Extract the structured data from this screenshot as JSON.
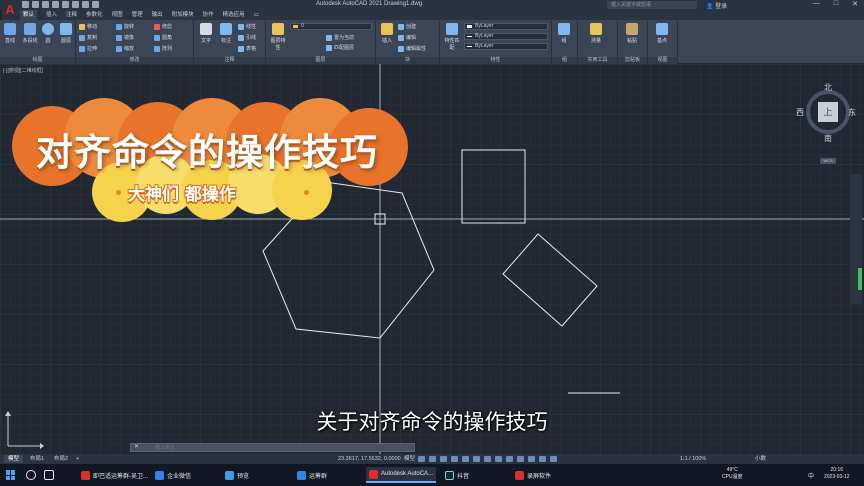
{
  "window": {
    "title": "Autodesk AutoCAD 2021    Drawing1.dwg",
    "search_placeholder": "键入关键字或短语",
    "login_label": "登录",
    "minimize": "—",
    "maximize": "□",
    "close": "✕"
  },
  "ribbon_tabs": [
    "默认",
    "插入",
    "注释",
    "参数化",
    "视图",
    "管理",
    "输出",
    "附加模块",
    "协作",
    "精选应用",
    "▭"
  ],
  "ribbon": {
    "groups": [
      {
        "label": "绘图",
        "buttons": [
          "直线",
          "多段线",
          "圆",
          "圆弧"
        ]
      },
      {
        "label": "修改",
        "buttons": [
          "移动",
          "旋转",
          "修剪",
          "复制",
          "镜像",
          "圆角",
          "拉伸",
          "缩放",
          "阵列"
        ]
      },
      {
        "label": "注释",
        "buttons": [
          "文字",
          "标注",
          "线性",
          "引线",
          "表格"
        ]
      },
      {
        "label": "图层",
        "buttons": [
          "图层特性",
          "置为当前",
          "匹配图层"
        ]
      },
      {
        "label": "块",
        "buttons": [
          "插入",
          "创建",
          "编辑",
          "编辑属性"
        ]
      },
      {
        "label": "特性",
        "buttons": [
          "特性匹配"
        ]
      },
      {
        "label": "组",
        "buttons": [
          "组"
        ]
      },
      {
        "label": "实用工具",
        "buttons": [
          "测量"
        ]
      },
      {
        "label": "剪贴板",
        "buttons": [
          "粘贴"
        ]
      },
      {
        "label": "视图",
        "buttons": [
          "基点"
        ]
      }
    ],
    "layer_combo": "0",
    "color_combo": "ByLayer",
    "linetype_combo": "ByLayer",
    "lineweight_combo": "ByLayer"
  },
  "viewport_label": "[-][俯视][二维线框]",
  "navcube": {
    "top": "上",
    "north": "北",
    "south": "南",
    "east": "东",
    "west": "西",
    "wcs": "WCS"
  },
  "overlay": {
    "title": "对齐命令的操作技巧",
    "subtitle": "大神们 都操作"
  },
  "caption": "关于对齐命令的操作技巧",
  "command_line": {
    "close": "✕",
    "placeholder": "键入命令"
  },
  "layout_tabs": [
    "模型",
    "布局1",
    "布局2",
    "+"
  ],
  "status": {
    "coordinates": "23.3617, 17.5632, 0.0000",
    "mode": "模型",
    "scale": "1:1 / 100%",
    "units": "小数"
  },
  "taskbar": {
    "apps": [
      {
        "label": "即巴适运筹群-吴卫...",
        "color": "#d8312c"
      },
      {
        "label": "企业微信",
        "color": "#2d86e3"
      },
      {
        "label": "预览",
        "color": "#3e9be8"
      },
      {
        "label": "运筹群",
        "color": "#2d86e3"
      },
      {
        "label": "Autodesk AutoCA...",
        "color": "#d8312c",
        "active": true
      },
      {
        "label": "抖音",
        "color": "#222222"
      },
      {
        "label": "录屏软件",
        "color": "#d8312c"
      }
    ],
    "temperature": "49°C",
    "temp_label": "CPU温度",
    "language": "中",
    "time": "20:16",
    "date": "2023-03-12"
  },
  "colors": {
    "accent_orange": "#e8732a",
    "accent_yellow": "#f5d34a",
    "canvas_bg": "#212832"
  }
}
